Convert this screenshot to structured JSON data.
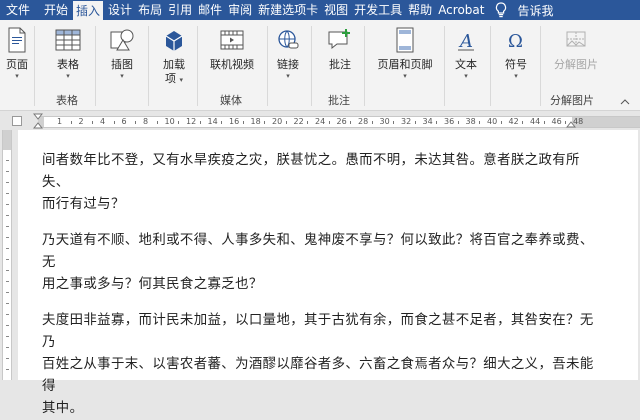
{
  "ribbon": {
    "tabs": [
      "文件",
      "开始",
      "插入",
      "设计",
      "布局",
      "引用",
      "邮件",
      "审阅",
      "新建选项卡",
      "视图",
      "开发工具",
      "帮助",
      "Acrobat"
    ],
    "active_tab": "插入",
    "tell_me": "告诉我",
    "buttons": {
      "pages": "页面",
      "table": "表格",
      "illustrations": "插图",
      "addins": "加载",
      "addins2": "项",
      "online_video": "联机视频",
      "links": "链接",
      "comment": "批注",
      "header_footer": "页眉和页脚",
      "text": "文本",
      "symbols": "符号",
      "split_image": "分解图片"
    },
    "groups": {
      "tables": "表格",
      "media": "媒体",
      "comments": "批注",
      "split_image": "分解图片"
    }
  },
  "ruler": {
    "numbers": [
      "1",
      "2",
      "4",
      "6",
      "8",
      "10",
      "12",
      "14",
      "16",
      "18",
      "20",
      "22",
      "24",
      "26",
      "28",
      "30",
      "32",
      "34",
      "36",
      "38",
      "40",
      "42",
      "44",
      "46",
      "48"
    ]
  },
  "document": {
    "paragraphs": [
      [
        "间者数年比不登，又有水旱疾疫之灾，朕甚忧之。愚而不明，未达其咎。意者朕之政有所失、",
        "而行有过与？"
      ],
      [
        "乃天道有不顺、地利或不得、人事多失和、鬼神废不享与？何以致此？将百官之奉养或费、无",
        "用之事或多与？何其民食之寡乏也？"
      ],
      [
        "夫度田非益寡，而计民未加益，以口量地，其于古犹有余，而食之甚不足者，其咎安在？无乃",
        "百姓之从事于末、以害农者蕃、为酒醪以靡谷者多、六畜之食焉者众与？细大之义，吾未能得",
        "其中。"
      ]
    ]
  },
  "colors": {
    "accent": "#2b579a",
    "ribbon_bg": "#f3f3f3",
    "workspace": "#e6e6e6"
  }
}
